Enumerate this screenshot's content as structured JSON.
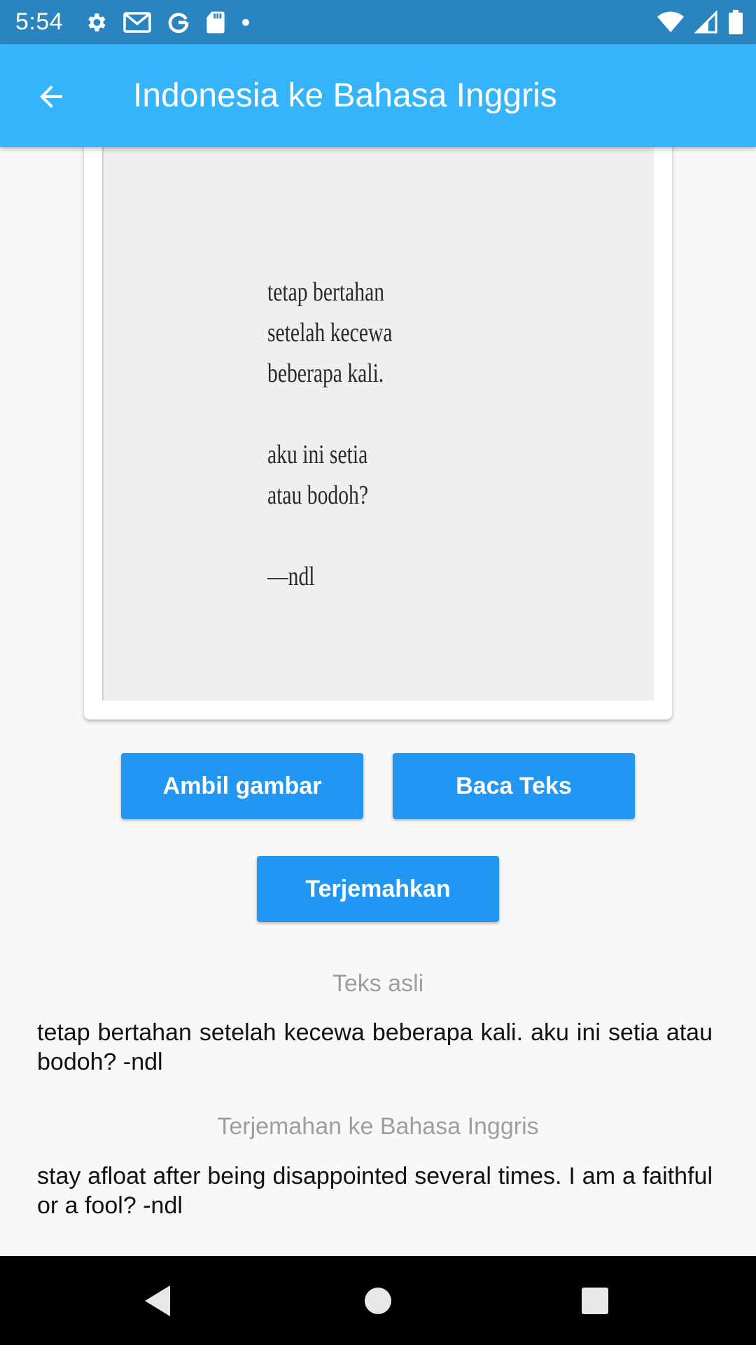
{
  "status_bar": {
    "time": "5:54",
    "left_icons": [
      "settings-icon",
      "gmail-icon",
      "google-icon",
      "sd-card-icon",
      "dot-icon"
    ],
    "right_icons": [
      "wifi-icon",
      "signal-icon",
      "battery-icon"
    ]
  },
  "app_bar": {
    "title": "Indonesia ke Bahasa Inggris",
    "back_icon": "arrow-back-icon",
    "color": "#35b4fb"
  },
  "image": {
    "lines": [
      "tetap bertahan",
      "setelah kecewa",
      "beberapa kali.",
      "",
      "aku ini setia",
      "atau bodoh?",
      "",
      "—ndl"
    ]
  },
  "buttons": {
    "take_picture": "Ambil gambar",
    "read_text": "Baca Teks",
    "translate": "Terjemahkan",
    "color": "#2196f3"
  },
  "original": {
    "label": "Teks asli",
    "text": "tetap bertahan setelah kecewa beberapa kali. aku ini setia atau bodoh? -ndl"
  },
  "translation": {
    "label": "Terjemahan ke Bahasa Inggris",
    "text": "stay afloat after being disappointed several times. I am a faithful or a fool? -ndl"
  },
  "nav_bar": {
    "icons": [
      "nav-back-icon",
      "nav-home-icon",
      "nav-recent-icon"
    ]
  }
}
